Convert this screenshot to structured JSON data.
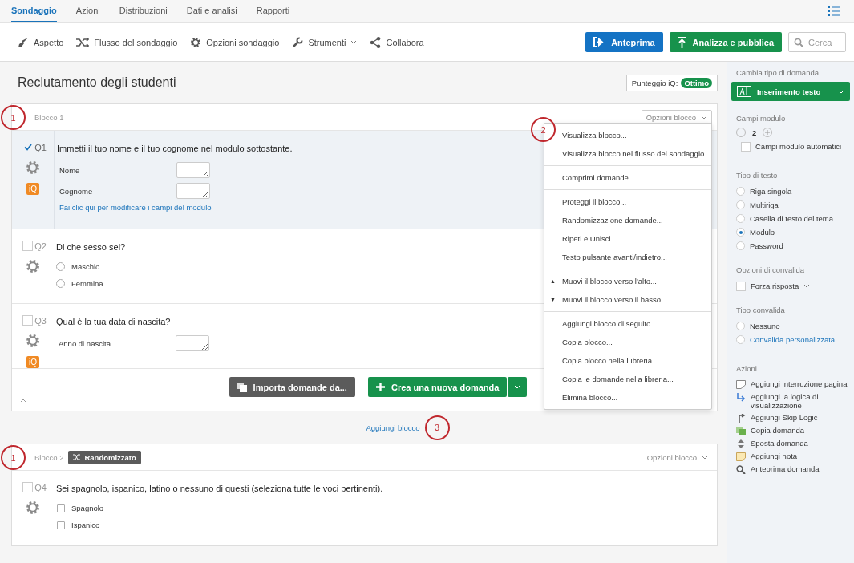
{
  "tabs": [
    {
      "label": "Sondaggio",
      "selected": true
    },
    {
      "label": "Azioni",
      "selected": false
    },
    {
      "label": "Distribuzioni",
      "selected": false
    },
    {
      "label": "Dati e analisi",
      "selected": false
    },
    {
      "label": "Rapporti",
      "selected": false
    }
  ],
  "toolbar": [
    {
      "label": "Aspetto",
      "kind": "brush",
      "caret": false
    },
    {
      "label": "Flusso del sondaggio",
      "kind": "flow",
      "caret": false
    },
    {
      "label": "Opzioni sondaggio",
      "kind": "gear",
      "caret": false
    },
    {
      "label": "Strumenti",
      "kind": "wrench",
      "caret": true
    },
    {
      "label": "Collabora",
      "kind": "share",
      "caret": false
    }
  ],
  "preview_button": "Anteprima",
  "publish_button": "Analizza e pubblica",
  "search": {
    "placeholder": "Cerca"
  },
  "survey_title": "Reclutamento degli studenti",
  "score": {
    "label": "Punteggio iQ:",
    "badge": "Ottimo"
  },
  "blocks": [
    {
      "title": "Blocco 1",
      "marker": "1",
      "options": "Opzioni blocco",
      "questions": [
        {
          "number": "Q1",
          "selected": true,
          "iq": "iQ",
          "text": "Immetti il tuo nome e il tuo cognome nel modulo sottostante.",
          "kind": "form",
          "fields": [
            "Nome",
            "Cognome"
          ],
          "link": "Fai clic qui per modificare i campi del modulo"
        },
        {
          "number": "Q2",
          "selected": false,
          "text": "Di che sesso sei?",
          "kind": "radio",
          "choices": [
            "Maschio",
            "Femmina"
          ]
        },
        {
          "number": "Q3",
          "selected": false,
          "iq": "iQ",
          "text": "Qual è la tua data di nascita?",
          "kind": "form",
          "fields": [
            "Anno di nascita"
          ]
        }
      ],
      "footer": {
        "import": "Importa domande da...",
        "create": "Crea una nuova domanda"
      }
    },
    {
      "title": "Blocco 2",
      "badge": "Randomizzato",
      "marker": "1",
      "options": "Opzioni blocco",
      "questions": [
        {
          "number": "Q4",
          "selected": false,
          "text": "Sei spagnolo, ispanico, latino o nessuno di questi (seleziona tutte le voci pertinenti).",
          "kind": "checkbox",
          "choices": [
            "Spagnolo",
            "Ispanico"
          ]
        }
      ]
    }
  ],
  "add_block": {
    "label": "Aggiungi blocco",
    "marker": "3"
  },
  "block_menu": {
    "marker": "2",
    "groups": [
      [
        {
          "label": "Visualizza blocco..."
        },
        {
          "label": "Visualizza blocco nel flusso del sondaggio..."
        }
      ],
      [
        {
          "label": "Comprimi domande..."
        }
      ],
      [
        {
          "label": "Proteggi il blocco..."
        },
        {
          "label": "Randomizzazione domande..."
        },
        {
          "label": "Ripeti e Unisci..."
        },
        {
          "label": "Testo pulsante avanti/indietro..."
        }
      ],
      [
        {
          "label": "Muovi il blocco verso l'alto...",
          "arrow": "▲"
        },
        {
          "label": "Muovi il blocco verso il basso...",
          "arrow": "▼"
        }
      ],
      [
        {
          "label": "Aggiungi blocco di seguito"
        },
        {
          "label": "Copia blocco..."
        },
        {
          "label": "Copia blocco nella Libreria..."
        },
        {
          "label": "Copia le domande nella libreria..."
        },
        {
          "label": "Elimina blocco..."
        }
      ]
    ]
  },
  "sidebar": {
    "type_heading": "Cambia tipo di domanda",
    "type_button": "Inserimento testo",
    "fields_heading": "Campi modulo",
    "fields_count": "2",
    "auto_fields": {
      "label": "Campi modulo automatici",
      "checked": false
    },
    "text_type_heading": "Tipo di testo",
    "text_types": [
      {
        "label": "Riga singola",
        "selected": false
      },
      {
        "label": "Multiriga",
        "selected": false
      },
      {
        "label": "Casella di testo del tema",
        "selected": false
      },
      {
        "label": "Modulo",
        "selected": true
      },
      {
        "label": "Password",
        "selected": false
      }
    ],
    "validation_heading": "Opzioni di convalida",
    "force": {
      "label": "Forza risposta",
      "checked": false
    },
    "validation_type_heading": "Tipo convalida",
    "validation_types": [
      {
        "label": "Nessuno",
        "selected": false,
        "kind": "option"
      },
      {
        "label": "Convalida personalizzata",
        "selected": false,
        "kind": "link"
      }
    ],
    "actions_heading": "Azioni",
    "actions": [
      {
        "label": "Aggiungi interruzione pagina",
        "kind": "pagebreak"
      },
      {
        "label": "Aggiungi la logica di visualizzazione",
        "kind": "display"
      },
      {
        "label": "Aggiungi Skip Logic",
        "kind": "skip"
      },
      {
        "label": "Copia domanda",
        "kind": "copy"
      },
      {
        "label": "Sposta domanda",
        "kind": "move"
      },
      {
        "label": "Aggiungi nota",
        "kind": "note"
      },
      {
        "label": "Anteprima domanda",
        "kind": "preview"
      }
    ]
  }
}
